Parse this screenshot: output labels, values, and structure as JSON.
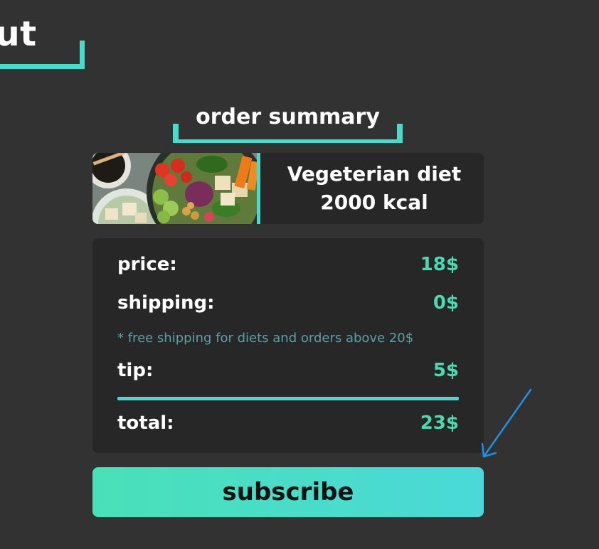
{
  "page": {
    "title": "out"
  },
  "order_summary": {
    "heading": "order summary",
    "product": {
      "image_name": "vegetarian-bowl-image",
      "name": "Vegeterian diet",
      "calories": "2000 kcal"
    },
    "rows": {
      "price": {
        "label": "price:",
        "value": "18$"
      },
      "shipping": {
        "label": "shipping:",
        "value": "0$"
      },
      "tip": {
        "label": "tip:",
        "value": "5$"
      },
      "total": {
        "label": "total:",
        "value": "23$"
      }
    },
    "shipping_note": "* free shipping for diets and orders above 20$"
  },
  "actions": {
    "subscribe_label": "subscribe"
  },
  "colors": {
    "background": "#323232",
    "card": "#272727",
    "accent": "#4ad9cc",
    "value_text": "#4ad9b0",
    "note_text": "#5f9ea8",
    "annotation_arrow": "#1e90e8"
  }
}
